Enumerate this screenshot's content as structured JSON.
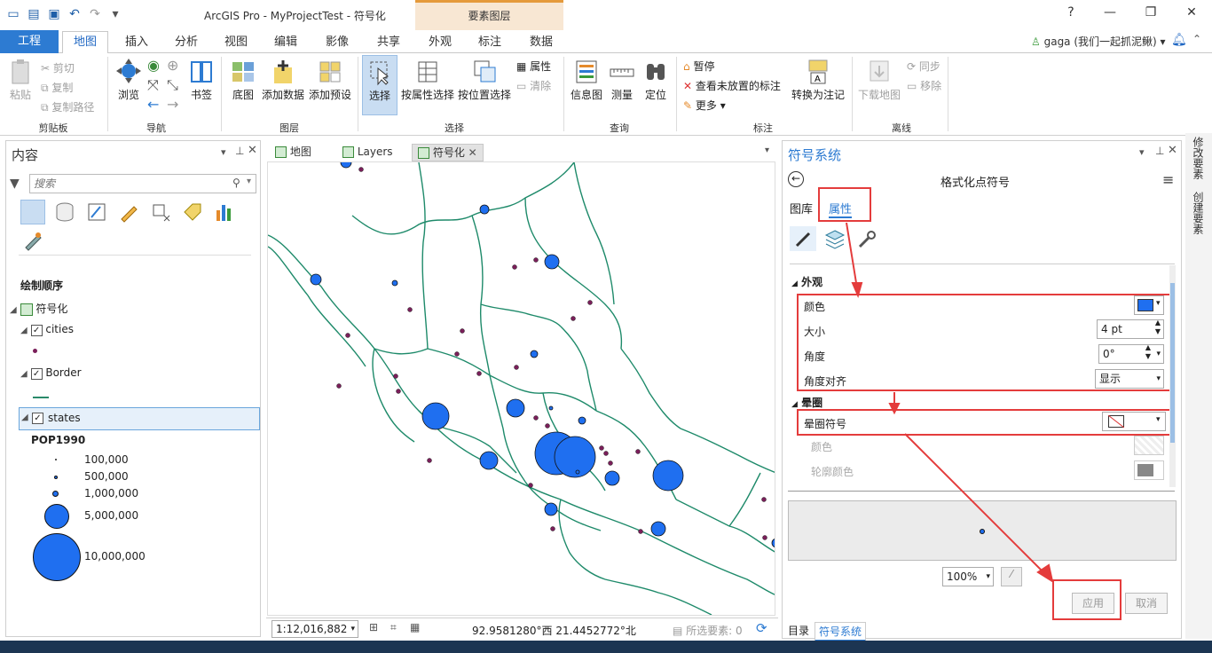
{
  "window": {
    "title": "ArcGIS Pro - MyProjectTest - 符号化",
    "context_group": "要素图层",
    "help": "?",
    "user": "gaga (我们一起抓泥鳅)"
  },
  "tabs": [
    "工程",
    "地图",
    "插入",
    "分析",
    "视图",
    "编辑",
    "影像",
    "共享",
    "外观",
    "标注",
    "数据"
  ],
  "ribbon": {
    "clipboard": {
      "paste": "粘贴",
      "cut": "剪切",
      "copy": "复制",
      "copy_path": "复制路径",
      "group": "剪贴板"
    },
    "navigate": {
      "explore": "浏览",
      "bookmarks": "书签",
      "group": "导航"
    },
    "layer": {
      "basemap": "底图",
      "add_data": "添加数据",
      "add_preset": "添加预设",
      "group": "图层"
    },
    "selection": {
      "select": "选择",
      "select_by_attr": "按属性选择",
      "select_by_loc": "按位置选择",
      "attributes": "属性",
      "clear": "清除",
      "group": "选择"
    },
    "inquiry": {
      "infographic": "信息图",
      "measure": "测量",
      "locate": "定位",
      "group": "查询"
    },
    "labeling": {
      "pause": "暂停",
      "view_unplaced": "查看未放置的标注",
      "more": "更多",
      "convert": "转换为注记",
      "group": "标注"
    },
    "offline": {
      "download": "下载地图",
      "sync": "同步",
      "remove": "移除",
      "group": "离线"
    }
  },
  "contents": {
    "title": "内容",
    "search_placeholder": "搜索",
    "drawing_order": "绘制顺序",
    "map_name": "符号化",
    "layers": [
      {
        "name": "cities",
        "checked": true
      },
      {
        "name": "Border",
        "checked": true
      },
      {
        "name": "states",
        "checked": true
      }
    ],
    "legend_field": "POP1990",
    "legend": [
      "100,000",
      "500,000",
      "1,000,000",
      "5,000,000",
      "10,000,000"
    ]
  },
  "map_tabs": [
    "地图",
    "Layers",
    "符号化"
  ],
  "status": {
    "scale": "1:12,016,882",
    "coords": "92.9581280°西 21.4452772°北",
    "selected": "所选要素: 0"
  },
  "symbology": {
    "title": "符号系统",
    "subtitle": "格式化点符号",
    "tab_gallery": "图库",
    "tab_properties": "属性",
    "section_appearance": "外观",
    "color_label": "颜色",
    "size_label": "大小",
    "size_value": "4 pt",
    "angle_label": "角度",
    "angle_value": "0°",
    "angle_align_label": "角度对齐",
    "angle_align_value": "显示",
    "section_halo": "晕圈",
    "halo_symbol_label": "晕圈符号",
    "halo_color_label": "颜色",
    "halo_outline_label": "轮廓颜色",
    "zoom": "100%",
    "apply": "应用",
    "cancel": "取消",
    "bottom_tabs": [
      "目录",
      "符号系统"
    ],
    "symbol_color": "#1f6ff0"
  },
  "right_strip": [
    "修改要素",
    "创建要素"
  ]
}
